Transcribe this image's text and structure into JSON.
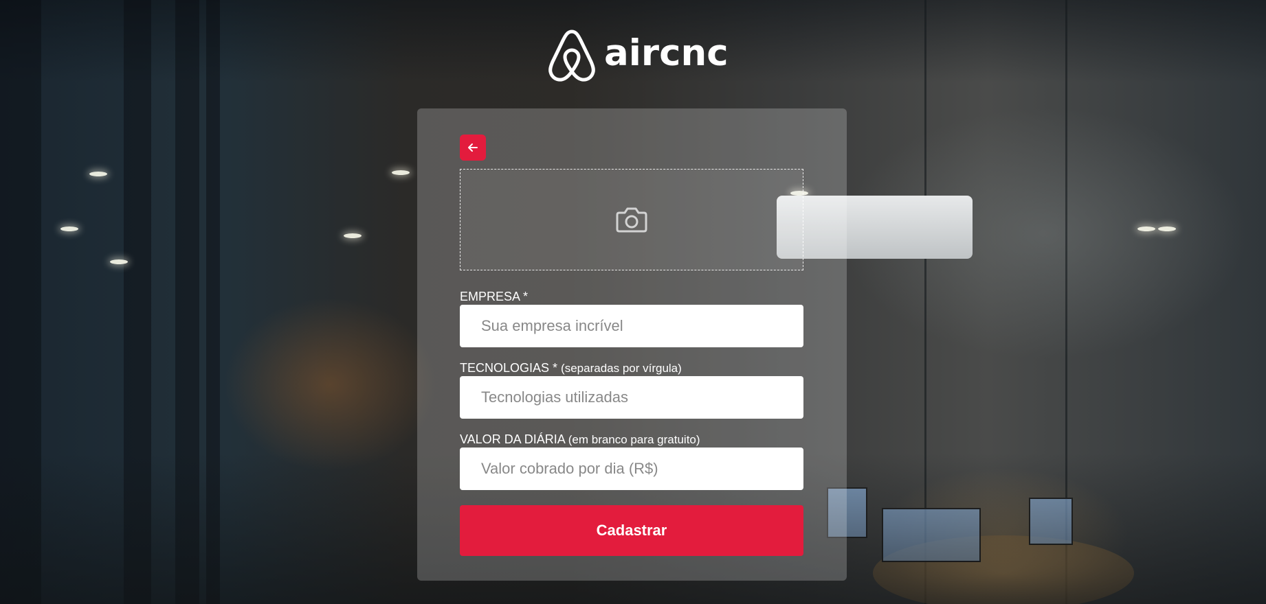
{
  "brand": {
    "name": "aircnc",
    "logo_icon": "airbnb-belo-icon"
  },
  "form": {
    "back_icon": "arrow-left-icon",
    "upload_icon": "camera-icon",
    "empresa": {
      "label": "EMPRESA *",
      "placeholder": "Sua empresa incrível",
      "value": ""
    },
    "tecnologias": {
      "label": "TECNOLOGIAS *",
      "hint": "(separadas por vírgula)",
      "placeholder": "Tecnologias utilizadas",
      "value": ""
    },
    "valor": {
      "label": "VALOR DA DIÁRIA",
      "hint": "(em branco para gratuito)",
      "placeholder": "Valor cobrado por dia (R$)",
      "value": ""
    },
    "submit_label": "Cadastrar"
  },
  "colors": {
    "accent": "#e31c3d",
    "text_light": "#ffffff",
    "input_bg": "#ffffff",
    "placeholder": "#888888"
  }
}
